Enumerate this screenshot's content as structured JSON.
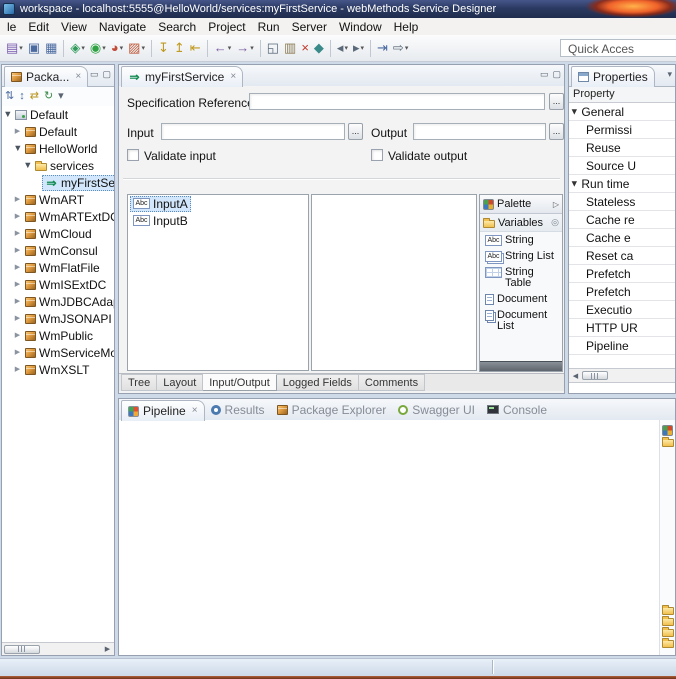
{
  "window": {
    "title": "workspace - localhost:5555@HelloWorld/services:myFirstService - webMethods Service Designer"
  },
  "menubar": {
    "items": [
      "le",
      "Edit",
      "View",
      "Navigate",
      "Search",
      "Project",
      "Run",
      "Server",
      "Window",
      "Help"
    ]
  },
  "toolbar": {
    "quick_access_label": "Quick Acces",
    "icons": [
      {
        "name": "new-wizard-icon",
        "glyph": "▤",
        "color": "#7a5ab0",
        "dropdown": true
      },
      {
        "name": "save-icon",
        "glyph": "▣",
        "color": "#4a6aa0"
      },
      {
        "name": "save-all-icon",
        "glyph": "▦",
        "color": "#4a6aa0"
      },
      {
        "sep": true
      },
      {
        "name": "debug-icon",
        "glyph": "◈",
        "color": "#2f9a5a",
        "dropdown": true
      },
      {
        "name": "run-icon",
        "glyph": "◉",
        "color": "#2fa244",
        "dropdown": true
      },
      {
        "name": "profile-icon",
        "glyph": "◕",
        "color": "#c24b38",
        "dropdown": true
      },
      {
        "name": "external-tools-icon",
        "glyph": "▨",
        "color": "#c05a3a",
        "dropdown": true
      },
      {
        "sep": true
      },
      {
        "name": "step-into-icon",
        "glyph": "↧",
        "color": "#c09a20"
      },
      {
        "name": "step-over-icon",
        "glyph": "↥",
        "color": "#c09a20"
      },
      {
        "name": "step-return-icon",
        "glyph": "⇤",
        "color": "#c09a20"
      },
      {
        "sep": true
      },
      {
        "name": "back-icon",
        "glyph": "←",
        "color": "#7a5aa0",
        "dropdown": true
      },
      {
        "name": "forward-icon",
        "glyph": "→",
        "color": "#7a5aa0",
        "dropdown": true
      },
      {
        "sep": true
      },
      {
        "name": "copy-icon",
        "glyph": "◱",
        "color": "#5a6a7a"
      },
      {
        "name": "paste-icon",
        "glyph": "▥",
        "color": "#8a7a50"
      },
      {
        "name": "delete-icon",
        "glyph": "×",
        "color": "#c0392b"
      },
      {
        "name": "pin-icon",
        "glyph": "◆",
        "color": "#3a8a8a"
      },
      {
        "sep": true
      },
      {
        "name": "prev-annotation-icon",
        "glyph": "◂",
        "color": "#5a6a7a",
        "dropdown": true
      },
      {
        "name": "next-annotation-icon",
        "glyph": "▸",
        "color": "#5a6a7a",
        "dropdown": true
      },
      {
        "sep": true
      },
      {
        "name": "last-edit-location-icon",
        "glyph": "⇥",
        "color": "#4a6aa0"
      },
      {
        "name": "forward-history-icon",
        "glyph": "⇨",
        "color": "#5a6a7a",
        "dropdown": true
      }
    ]
  },
  "package_navigator": {
    "tab_label": "Packa...",
    "toolbar_icons": [
      {
        "name": "collapse-all-icon",
        "glyph": "⇅",
        "color": "#4a6aa0"
      },
      {
        "name": "expand-all-icon",
        "glyph": "↕",
        "color": "#4a6aa0"
      },
      {
        "name": "link-with-editor-icon",
        "glyph": "⇄",
        "color": "#b8941e"
      },
      {
        "name": "refresh-icon",
        "glyph": "↻",
        "color": "#3a8a4a"
      },
      {
        "name": "view-menu-icon",
        "glyph": "▾",
        "color": "#5a6472"
      }
    ],
    "tree": [
      {
        "label": "Default",
        "depth": 0,
        "icon": "server",
        "state": "expanded",
        "selected": false
      },
      {
        "label": "Default",
        "depth": 1,
        "icon": "package",
        "state": "collapsed",
        "selected": false
      },
      {
        "label": "HelloWorld",
        "depth": 1,
        "icon": "package",
        "state": "expanded",
        "selected": false
      },
      {
        "label": "services",
        "depth": 2,
        "icon": "folder",
        "state": "expanded",
        "selected": false
      },
      {
        "label": "myFirstSe",
        "depth": 3,
        "icon": "flow",
        "state": "leaf",
        "selected": true
      },
      {
        "label": "WmART",
        "depth": 1,
        "icon": "package",
        "state": "collapsed",
        "selected": false
      },
      {
        "label": "WmARTExtDC",
        "depth": 1,
        "icon": "package",
        "state": "collapsed",
        "selected": false
      },
      {
        "label": "WmCloud",
        "depth": 1,
        "icon": "package",
        "state": "collapsed",
        "selected": false
      },
      {
        "label": "WmConsul",
        "depth": 1,
        "icon": "package",
        "state": "collapsed",
        "selected": false
      },
      {
        "label": "WmFlatFile",
        "depth": 1,
        "icon": "package",
        "state": "collapsed",
        "selected": false
      },
      {
        "label": "WmISExtDC",
        "depth": 1,
        "icon": "package",
        "state": "collapsed",
        "selected": false
      },
      {
        "label": "WmJDBCAdap",
        "depth": 1,
        "icon": "package",
        "state": "collapsed",
        "selected": false
      },
      {
        "label": "WmJSONAPI",
        "depth": 1,
        "icon": "package",
        "state": "collapsed",
        "selected": false
      },
      {
        "label": "WmPublic",
        "depth": 1,
        "icon": "package",
        "state": "collapsed",
        "selected": false
      },
      {
        "label": "WmServiceMo",
        "depth": 1,
        "icon": "package",
        "state": "collapsed",
        "selected": false
      },
      {
        "label": "WmXSLT",
        "depth": 1,
        "icon": "package",
        "state": "collapsed",
        "selected": false
      }
    ]
  },
  "editor": {
    "tab_label": "myFirstService",
    "form": {
      "spec_ref_label": "Specification Reference",
      "spec_ref_value": "",
      "input_label": "Input",
      "input_value": "",
      "output_label": "Output",
      "output_value": "",
      "validate_input_label": "Validate input",
      "validate_output_label": "Validate output",
      "browse_label": "..."
    },
    "input_vars": [
      {
        "label": "InputA",
        "icon": "string",
        "selected": true
      },
      {
        "label": "InputB",
        "icon": "string",
        "selected": false
      }
    ],
    "output_vars": [],
    "palette": {
      "title": "Palette",
      "sections": [
        {
          "label": "Variables",
          "items": [
            {
              "label": "String",
              "icon": "string"
            },
            {
              "label": "String List",
              "icon": "string-list"
            },
            {
              "label": "String Table",
              "icon": "string-table"
            },
            {
              "label": "Document",
              "icon": "document"
            },
            {
              "label": "Document List",
              "icon": "document-list"
            }
          ]
        }
      ]
    },
    "bottom_tabs": [
      {
        "label": "Tree",
        "active": false
      },
      {
        "label": "Layout",
        "active": false
      },
      {
        "label": "Input/Output",
        "active": true
      },
      {
        "label": "Logged Fields",
        "active": false
      },
      {
        "label": "Comments",
        "active": false
      }
    ]
  },
  "properties": {
    "tab_label": "Properties",
    "column_header": "Property",
    "rows": [
      {
        "label": "General",
        "type": "group"
      },
      {
        "label": "Permissi",
        "type": "item"
      },
      {
        "label": "Reuse",
        "type": "item"
      },
      {
        "label": "Source U",
        "type": "item"
      },
      {
        "label": "Run time",
        "type": "group"
      },
      {
        "label": "Stateless",
        "type": "item"
      },
      {
        "label": "Cache re",
        "type": "item"
      },
      {
        "label": "Cache e",
        "type": "item"
      },
      {
        "label": "Reset ca",
        "type": "item"
      },
      {
        "label": "Prefetch",
        "type": "item"
      },
      {
        "label": "Prefetch",
        "type": "item"
      },
      {
        "label": "Executio",
        "type": "item"
      },
      {
        "label": "HTTP UR",
        "type": "item"
      },
      {
        "label": "Pipeline",
        "type": "item"
      }
    ]
  },
  "bottom_panel": {
    "tabs": [
      {
        "label": "Pipeline",
        "icon": "pipeline",
        "active": true
      },
      {
        "label": "Results",
        "icon": "results",
        "active": false
      },
      {
        "label": "Package Explorer",
        "icon": "package",
        "active": false
      },
      {
        "label": "Swagger UI",
        "icon": "swagger",
        "active": false
      },
      {
        "label": "Console",
        "icon": "console",
        "active": false
      }
    ],
    "side_icons": {
      "top": [
        "palette",
        "folder"
      ],
      "bottom": [
        "folder",
        "folder",
        "folder",
        "folder"
      ]
    }
  }
}
